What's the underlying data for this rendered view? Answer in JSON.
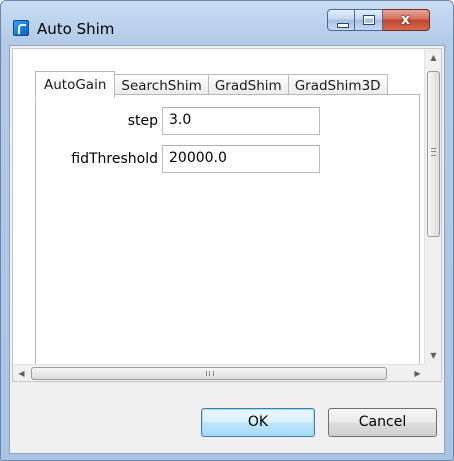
{
  "window": {
    "title": "Auto Shim",
    "controls": {
      "minimize": "minimize",
      "maximize": "maximize",
      "close": "x"
    }
  },
  "tabs": [
    {
      "label": "AutoGain",
      "active": true
    },
    {
      "label": "SearchShim",
      "active": false
    },
    {
      "label": "GradShim",
      "active": false
    },
    {
      "label": "GradShim3D",
      "active": false
    }
  ],
  "form": {
    "step": {
      "label": "step",
      "value": "3.0"
    },
    "fidThreshold": {
      "label": "fidThreshold",
      "value": "20000.0"
    }
  },
  "buttons": {
    "ok": "OK",
    "cancel": "Cancel"
  },
  "colors": {
    "title_gradient_top": "#c9dcf2",
    "close_red": "#c0452d",
    "default_button_border": "#3c7fb1"
  }
}
